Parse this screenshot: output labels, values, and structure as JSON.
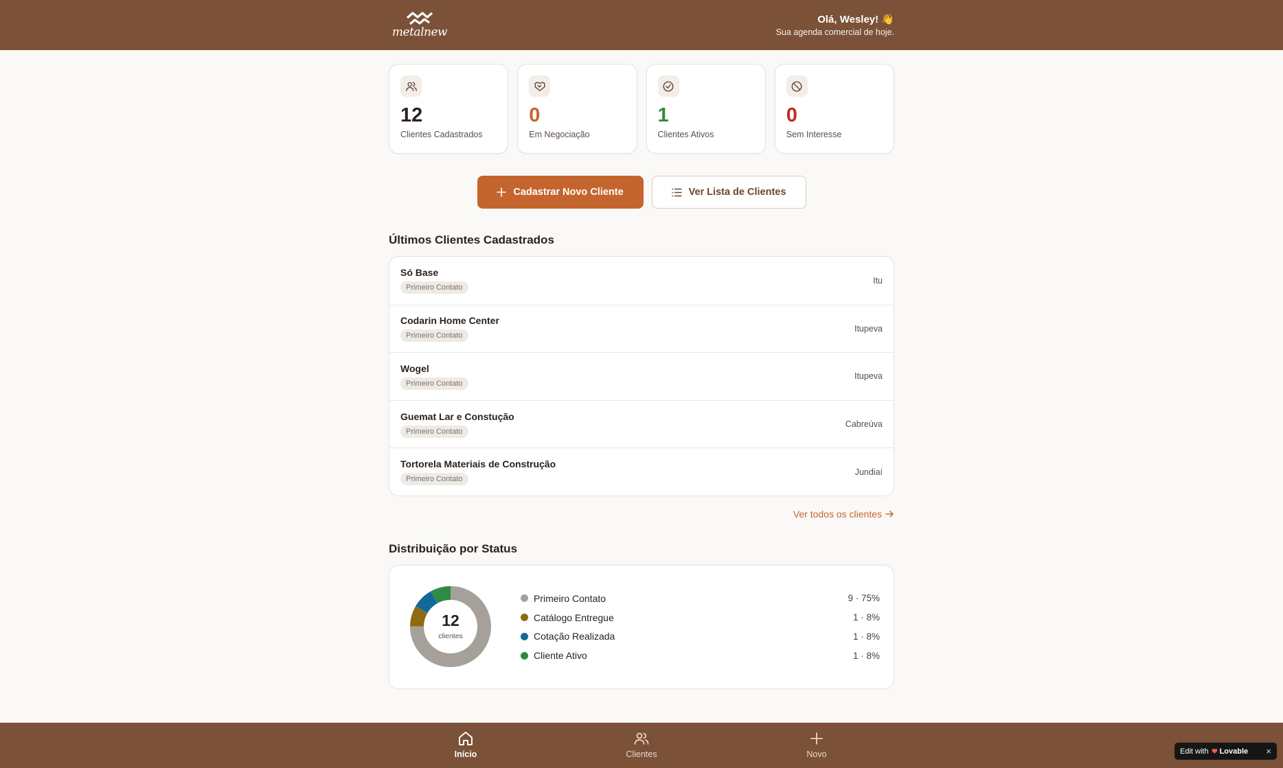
{
  "header": {
    "logo_text": "metalnew",
    "greeting": "Olá, Wesley! 👋",
    "subtitle": "Sua agenda comercial de hoje."
  },
  "stats": [
    {
      "value": "12",
      "label": "Clientes Cadastrados",
      "icon": "users-icon"
    },
    {
      "value": "0",
      "label": "Em Negociação",
      "icon": "handshake-icon"
    },
    {
      "value": "1",
      "label": "Clientes Ativos",
      "icon": "check-circle-icon"
    },
    {
      "value": "0",
      "label": "Sem Interesse",
      "icon": "ban-icon"
    }
  ],
  "actions": {
    "new_client": "Cadastrar Novo Cliente",
    "view_list": "Ver Lista de Clientes"
  },
  "recent": {
    "title": "Últimos Clientes Cadastrados",
    "clients": [
      {
        "name": "Só Base",
        "status": "Primeiro Contato",
        "city": "Itu"
      },
      {
        "name": "Codarin Home Center",
        "status": "Primeiro Contato",
        "city": "Itupeva"
      },
      {
        "name": "Wogel",
        "status": "Primeiro Contato",
        "city": "Itupeva"
      },
      {
        "name": "Guemat Lar e Constução",
        "status": "Primeiro Contato",
        "city": "Cabreúva"
      },
      {
        "name": "Tortorela Materiais de Construção",
        "status": "Primeiro Contato",
        "city": "Jundiaí"
      }
    ],
    "see_all": "Ver todos os clientes"
  },
  "distribution": {
    "title": "Distribuição por Status",
    "total": "12",
    "caption": "clientes",
    "items": [
      {
        "label": "Primeiro Contato",
        "value": "9 · 75%",
        "color": "#a6a09a"
      },
      {
        "label": "Catálogo Entregue",
        "value": "1 · 8%",
        "color": "#8e6b10"
      },
      {
        "label": "Cotação Realizada",
        "value": "1 · 8%",
        "color": "#14689a"
      },
      {
        "label": "Cliente Ativo",
        "value": "1 · 8%",
        "color": "#2f8a46"
      }
    ]
  },
  "chart_data": {
    "type": "pie",
    "categories": [
      "Primeiro Contato",
      "Catálogo Entregue",
      "Cotação Realizada",
      "Cliente Ativo"
    ],
    "values": [
      9,
      1,
      1,
      1
    ],
    "colors": [
      "#a6a09a",
      "#8e6b10",
      "#14689a",
      "#2f8a46"
    ],
    "title": "Distribuição por Status"
  },
  "nav": {
    "home": "Início",
    "clients": "Clientes",
    "new": "Novo"
  },
  "badge": {
    "prefix": "Edit with",
    "brand": "Lovable",
    "close": "×"
  }
}
